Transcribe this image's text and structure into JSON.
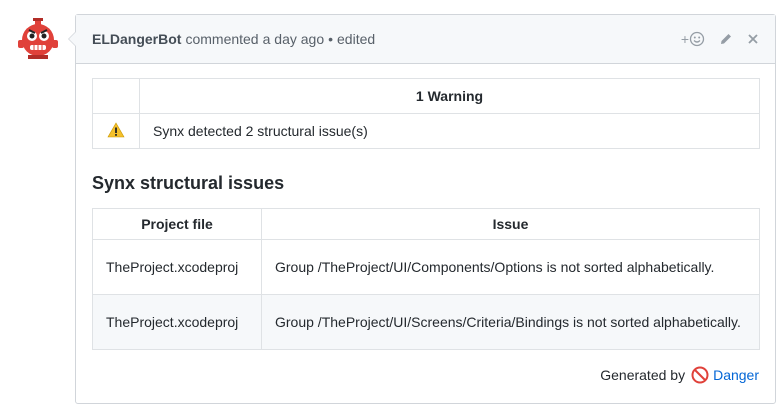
{
  "comment": {
    "author": "ELDangerBot",
    "action": "commented",
    "time": "a day ago",
    "separator": "•",
    "edited": "edited",
    "actions": {
      "reaction_plus": "+",
      "reaction_icon": "smiley-icon",
      "edit_icon": "pencil-icon",
      "close_icon": "close-icon"
    }
  },
  "warnings": {
    "header": "1 Warning",
    "rows": [
      {
        "icon": "warning-icon",
        "text": "Synx detected 2 structural issue(s)"
      }
    ]
  },
  "section_title": "Synx structural issues",
  "issues": {
    "columns": [
      "Project file",
      "Issue"
    ],
    "rows": [
      {
        "file": "TheProject.xcodeproj",
        "issue": "Group /TheProject/UI/Components/Options is not sorted alphabetically."
      },
      {
        "file": "TheProject.xcodeproj",
        "issue": "Group /TheProject/UI/Screens/Criteria/Bindings is not sorted alphabetically."
      }
    ]
  },
  "footer": {
    "generated_by": "Generated by",
    "link_label": "Danger",
    "link_icon": "no-entry-icon"
  },
  "colors": {
    "link": "#0366d6",
    "border": "#d1d5da",
    "header_bg": "#f6f8fa",
    "avatar_red": "#e0413a"
  }
}
